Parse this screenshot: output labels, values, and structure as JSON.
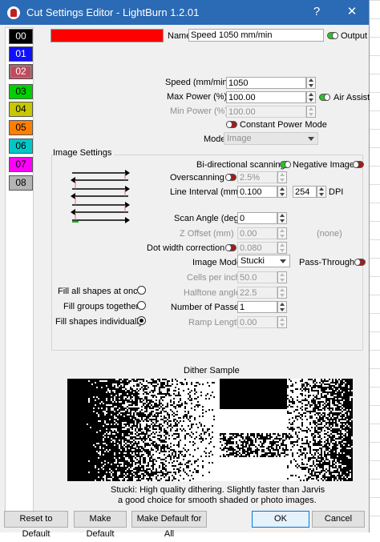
{
  "window": {
    "title": "Cut Settings Editor - LightBurn 1.2.01",
    "help_glyph": "?",
    "close_glyph": "✕"
  },
  "layers": [
    {
      "label": "00",
      "color": "#000000",
      "text_color": "#ffffff",
      "selected": false
    },
    {
      "label": "01",
      "color": "#1010ff",
      "text_color": "#ffffff",
      "selected": false
    },
    {
      "label": "02",
      "color": "#c24a5a",
      "text_color": "#ffffff",
      "selected": true
    },
    {
      "label": "03",
      "color": "#00d000",
      "text_color": "#000000",
      "selected": false
    },
    {
      "label": "04",
      "color": "#c8c800",
      "text_color": "#000000",
      "selected": false
    },
    {
      "label": "05",
      "color": "#ff8000",
      "text_color": "#000000",
      "selected": false
    },
    {
      "label": "06",
      "color": "#00c8c8",
      "text_color": "#000000",
      "selected": false
    },
    {
      "label": "07",
      "color": "#ff00ff",
      "text_color": "#000000",
      "selected": false
    },
    {
      "label": "08",
      "color": "#b4b4b4",
      "text_color": "#000000",
      "selected": false
    }
  ],
  "header": {
    "layer_color": "#ff0000",
    "name_label": "Name",
    "name_value": "Speed 1050 mm/min",
    "output_label": "Output",
    "output_on": true
  },
  "speed": {
    "label": "Speed (mm/min)",
    "value": "1050"
  },
  "max_power": {
    "label": "Max Power (%)",
    "value": "100.00"
  },
  "air_assist": {
    "label": "Air Assist",
    "on": true
  },
  "min_power": {
    "label": "Min Power (%)",
    "value": "100.00"
  },
  "constant_power": {
    "label": "Constant Power Mode",
    "on": false
  },
  "mode": {
    "label": "Mode",
    "value": "Image"
  },
  "image_settings": {
    "title": "Image Settings",
    "bidir": {
      "label": "Bi-directional scanning",
      "on": true
    },
    "negative": {
      "label": "Negative Image",
      "on": false
    },
    "overscan": {
      "label": "Overscanning",
      "on": false,
      "value": "2.5%"
    },
    "line_interval": {
      "label": "Line Interval (mm)",
      "value": "0.100",
      "dpi_value": "254",
      "dpi_label": "DPI"
    },
    "scan_angle": {
      "label": "Scan Angle (deg)",
      "value": "0"
    },
    "z_offset": {
      "label": "Z Offset (mm)",
      "value": "0.00",
      "none_label": "(none)"
    },
    "dot_width": {
      "label": "Dot width correction",
      "on": false,
      "value": "0.080"
    },
    "image_mode": {
      "label": "Image Mode",
      "value": "Stucki"
    },
    "pass_through": {
      "label": "Pass-Through",
      "on": false
    },
    "cells_per_inch": {
      "label": "Cells per inch",
      "value": "50.0"
    },
    "halftone_angle": {
      "label": "Halftone angle",
      "value": "22.5"
    },
    "num_passes": {
      "label": "Number of Passes",
      "value": "1"
    },
    "ramp_length": {
      "label": "Ramp Length",
      "value": "0.00"
    },
    "fill_options": [
      {
        "label": "Fill all shapes at once",
        "checked": false
      },
      {
        "label": "Fill groups together",
        "checked": false
      },
      {
        "label": "Fill shapes individually",
        "checked": true
      }
    ]
  },
  "dither": {
    "title": "Dither Sample",
    "description_line1": "Stucki: High quality dithering. Slightly faster than Jarvis",
    "description_line2": "a good choice for smooth shaded or photo images."
  },
  "buttons": {
    "reset": "Reset to Default",
    "make_default": "Make Default",
    "make_default_all": "Make Default for All",
    "ok": "OK",
    "cancel": "Cancel"
  }
}
